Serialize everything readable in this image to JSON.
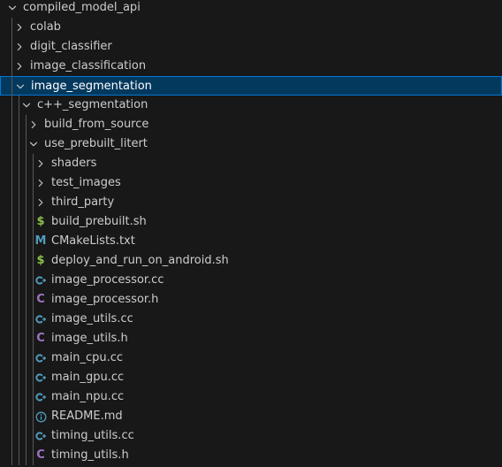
{
  "explorer": {
    "items": [
      {
        "name": "compiled_model_api",
        "type": "folder",
        "expanded": true,
        "depth": 0
      },
      {
        "name": "colab",
        "type": "folder",
        "expanded": false,
        "depth": 1
      },
      {
        "name": "digit_classifier",
        "type": "folder",
        "expanded": false,
        "depth": 1
      },
      {
        "name": "image_classification",
        "type": "folder",
        "expanded": false,
        "depth": 1
      },
      {
        "name": "image_segmentation",
        "type": "folder",
        "expanded": true,
        "depth": 1,
        "selected": true
      },
      {
        "name": "c++_segmentation",
        "type": "folder",
        "expanded": true,
        "depth": 2
      },
      {
        "name": "build_from_source",
        "type": "folder",
        "expanded": false,
        "depth": 3
      },
      {
        "name": "use_prebuilt_litert",
        "type": "folder",
        "expanded": true,
        "depth": 3
      },
      {
        "name": "shaders",
        "type": "folder",
        "expanded": false,
        "depth": 4
      },
      {
        "name": "test_images",
        "type": "folder",
        "expanded": false,
        "depth": 4
      },
      {
        "name": "third_party",
        "type": "folder",
        "expanded": false,
        "depth": 4
      },
      {
        "name": "build_prebuilt.sh",
        "type": "shell",
        "depth": 4
      },
      {
        "name": "CMakeLists.txt",
        "type": "cmake",
        "depth": 4
      },
      {
        "name": "deploy_and_run_on_android.sh",
        "type": "shell",
        "depth": 4
      },
      {
        "name": "image_processor.cc",
        "type": "cpp",
        "depth": 4
      },
      {
        "name": "image_processor.h",
        "type": "header",
        "depth": 4
      },
      {
        "name": "image_utils.cc",
        "type": "cpp",
        "depth": 4
      },
      {
        "name": "image_utils.h",
        "type": "header",
        "depth": 4
      },
      {
        "name": "main_cpu.cc",
        "type": "cpp",
        "depth": 4
      },
      {
        "name": "main_gpu.cc",
        "type": "cpp",
        "depth": 4
      },
      {
        "name": "main_npu.cc",
        "type": "cpp",
        "depth": 4
      },
      {
        "name": "README.md",
        "type": "info",
        "depth": 4
      },
      {
        "name": "timing_utils.cc",
        "type": "cpp",
        "depth": 4
      },
      {
        "name": "timing_utils.h",
        "type": "header",
        "depth": 4
      }
    ]
  },
  "icons": {
    "chevron_right": "chevron-right-icon",
    "chevron_down": "chevron-down-icon",
    "shell": {
      "glyph": "$",
      "color": "#8dc149"
    },
    "cmake": {
      "glyph": "M",
      "color": "#519aba"
    },
    "cpp": {
      "color": "#519aba"
    },
    "header": {
      "glyph": "C",
      "color": "#a074c4"
    },
    "info": {
      "color": "#519aba"
    }
  },
  "colors": {
    "background": "#181818",
    "selection_bg": "#04395e",
    "selection_border": "#0078d4",
    "text": "#cccccc",
    "indent_guide": "#585858"
  }
}
